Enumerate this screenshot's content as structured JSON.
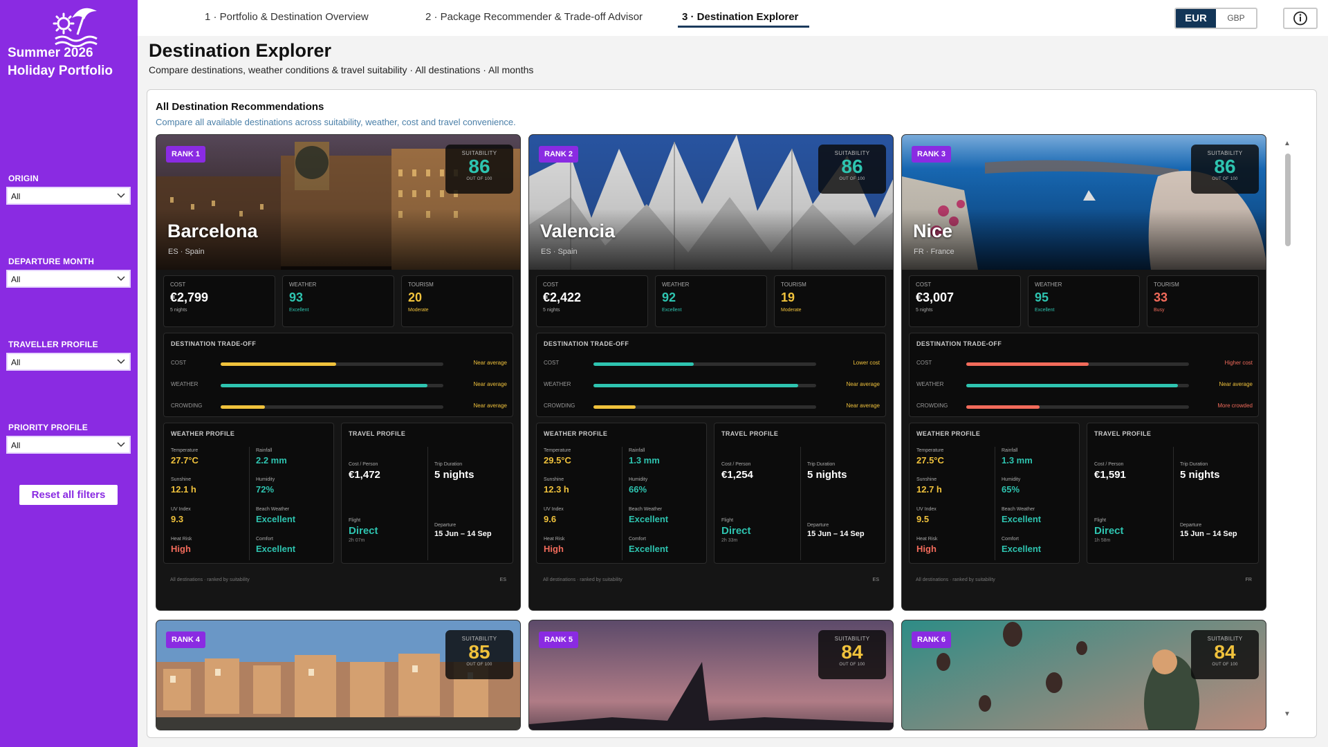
{
  "brand": {
    "title": "Summer 2026\nHoliday  Portfolio",
    "line1": "Summer 2026",
    "line2": "Holiday  Portfolio"
  },
  "filters": [
    {
      "label": "ORIGIN",
      "value": "All"
    },
    {
      "label": "DEPARTURE MONTH",
      "value": "All"
    },
    {
      "label": "TRAVELLER PROFILE",
      "value": "All"
    },
    {
      "label": "PRIORITY PROFILE",
      "value": "All"
    }
  ],
  "reset_label": "Reset all filters",
  "tabs": [
    {
      "label": "1 · Portfolio & Destination Overview"
    },
    {
      "label": "2 · Package Recommender & Trade-off Advisor"
    },
    {
      "label": "3 · Destination Explorer"
    }
  ],
  "currency": {
    "eur": "EUR",
    "gbp": "GBP"
  },
  "page": {
    "title": "Destination Explorer",
    "subtitle": "Compare destinations, weather conditions & travel suitability · All destinations · All months"
  },
  "panel": {
    "title": "All Destination Recommendations",
    "subtitle": "Compare all available destinations across suitability, weather, cost and travel convenience."
  },
  "labels": {
    "suitability": "SUITABILITY",
    "out_of": "OUT OF 100",
    "cost": "COST",
    "weather": "WEATHER",
    "tourism": "TOURISM",
    "tradeoff": "DESTINATION TRADE-OFF",
    "to_cost": "COST",
    "to_weather": "WEATHER",
    "to_crowding": "CROWDING",
    "weather_profile": "WEATHER PROFILE",
    "travel_profile": "TRAVEL PROFILE",
    "temperature": "Temperature",
    "rainfall": "Rainfall",
    "sunshine": "Sunshine",
    "humidity": "Humidity",
    "uv": "UV Index",
    "beach": "Beach Weather",
    "heat": "Heat Risk",
    "comfort": "Comfort",
    "cost_person": "Cost / Person",
    "trip_duration": "Trip Duration",
    "flight": "Flight",
    "departure": "Departure",
    "footer": "All destinations · ranked by suitability"
  },
  "colors": {
    "purple": "#8a2be2",
    "yellow": "#f0c23c",
    "teal": "#2ec4b0",
    "red": "#f26b5b"
  },
  "cards": [
    {
      "rank": "RANK 1",
      "suitability": "86",
      "city": "Barcelona",
      "country": "ES · Spain",
      "cost": "€2,799",
      "cost_sub": "5 nights",
      "weather": "93",
      "weather_sub": "Excellent",
      "tourism": "20",
      "tourism_sub": "Moderate",
      "tradeoff": [
        {
          "value": 0.52,
          "note": "Near average",
          "color": "yellow"
        },
        {
          "value": 0.93,
          "note": "Near average",
          "color": "teal"
        },
        {
          "value": 0.2,
          "note": "Near average",
          "color": "yellow"
        }
      ],
      "temperature": "27.7°C",
      "rainfall": "2.2 mm",
      "sunshine": "12.1 h",
      "humidity": "72%",
      "uv": "9.3",
      "beach": "Excellent",
      "heat": "High",
      "comfort": "Excellent",
      "cost_person": "€1,472",
      "trip_duration": "5 nights",
      "flight": "Direct",
      "flight_time": "2h 07m",
      "departure": "15 Jun – 14 Sep",
      "code": "ES"
    },
    {
      "rank": "RANK 2",
      "suitability": "86",
      "city": "Valencia",
      "country": "ES · Spain",
      "cost": "€2,422",
      "cost_sub": "5 nights",
      "weather": "92",
      "weather_sub": "Excellent",
      "tourism": "19",
      "tourism_sub": "Moderate",
      "tradeoff": [
        {
          "value": 0.45,
          "note": "Lower cost",
          "color": "teal"
        },
        {
          "value": 0.92,
          "note": "Near average",
          "color": "teal"
        },
        {
          "value": 0.19,
          "note": "Near average",
          "color": "yellow"
        }
      ],
      "temperature": "29.5°C",
      "rainfall": "1.3 mm",
      "sunshine": "12.3 h",
      "humidity": "66%",
      "uv": "9.6",
      "beach": "Excellent",
      "heat": "High",
      "comfort": "Excellent",
      "cost_person": "€1,254",
      "trip_duration": "5 nights",
      "flight": "Direct",
      "flight_time": "2h 33m",
      "departure": "15 Jun – 14 Sep",
      "code": "ES"
    },
    {
      "rank": "RANK 3",
      "suitability": "86",
      "city": "Nice",
      "country": "FR · France",
      "cost": "€3,007",
      "cost_sub": "5 nights",
      "weather": "95",
      "weather_sub": "Excellent",
      "tourism": "33",
      "tourism_sub": "Busy",
      "tradeoff": [
        {
          "value": 0.55,
          "note": "Higher cost",
          "color": "red"
        },
        {
          "value": 0.95,
          "note": "Near average",
          "color": "teal"
        },
        {
          "value": 0.33,
          "note": "More crowded",
          "color": "red"
        }
      ],
      "temperature": "27.5°C",
      "rainfall": "1.3 mm",
      "sunshine": "12.7 h",
      "humidity": "65%",
      "uv": "9.5",
      "beach": "Excellent",
      "heat": "High",
      "comfort": "Excellent",
      "cost_person": "€1,591",
      "trip_duration": "5 nights",
      "flight": "Direct",
      "flight_time": "1h 58m",
      "departure": "15 Jun – 14 Sep",
      "code": "FR"
    }
  ],
  "cards_bottom": [
    {
      "rank": "RANK 4",
      "suitability": "85"
    },
    {
      "rank": "RANK 5",
      "suitability": "84"
    },
    {
      "rank": "RANK 6",
      "suitability": "84"
    }
  ]
}
